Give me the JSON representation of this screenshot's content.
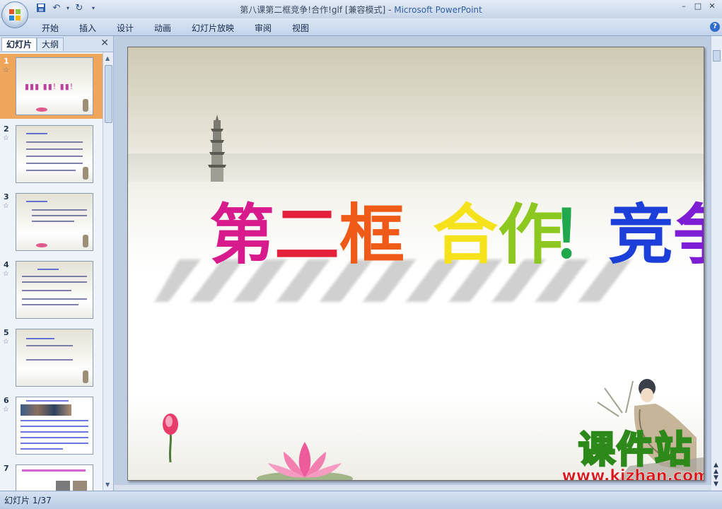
{
  "window": {
    "title": "第八课第二框竞争!合作!glf [兼容模式]",
    "separator": " - ",
    "app": "Microsoft PowerPoint",
    "min_label": "–",
    "max_label": "□",
    "close_label": "✕"
  },
  "quick_access": {
    "save_icon": "save-icon",
    "undo_icon": "undo-icon",
    "redo_icon": "redo-icon",
    "customize_icon": "customize-icon"
  },
  "ribbon": {
    "tabs": [
      "开始",
      "插入",
      "设计",
      "动画",
      "幻灯片放映",
      "审阅",
      "视图"
    ],
    "help_label": "?"
  },
  "left_pane": {
    "tab_slides": "幻灯片",
    "tab_outline": "大纲",
    "close_label": "✕",
    "slides": [
      {
        "num": "1",
        "selected": true
      },
      {
        "num": "2"
      },
      {
        "num": "3"
      },
      {
        "num": "4"
      },
      {
        "num": "5"
      },
      {
        "num": "6"
      },
      {
        "num": "7"
      }
    ],
    "star": "☆"
  },
  "slide": {
    "title_chars": [
      {
        "ch": "第",
        "color": "#d81b8c"
      },
      {
        "ch": "二",
        "color": "#e5203a"
      },
      {
        "ch": "框",
        "color": "#ef5a18"
      },
      {
        "ch": " ",
        "color": "#ffffff"
      },
      {
        "ch": "合",
        "color": "#f6e21a"
      },
      {
        "ch": "作",
        "color": "#8cc820"
      },
      {
        "ch": "！",
        "color": "#22a84c"
      },
      {
        "ch": "竞",
        "color": "#1b3fd8"
      },
      {
        "ch": "争",
        "color": "#7d1ed4"
      },
      {
        "ch": "！",
        "color": "#b220c8"
      }
    ]
  },
  "watermark": {
    "main": "课件站",
    "url": "www.kjzhan.com"
  },
  "status": {
    "text": "幻灯片 1/37"
  }
}
